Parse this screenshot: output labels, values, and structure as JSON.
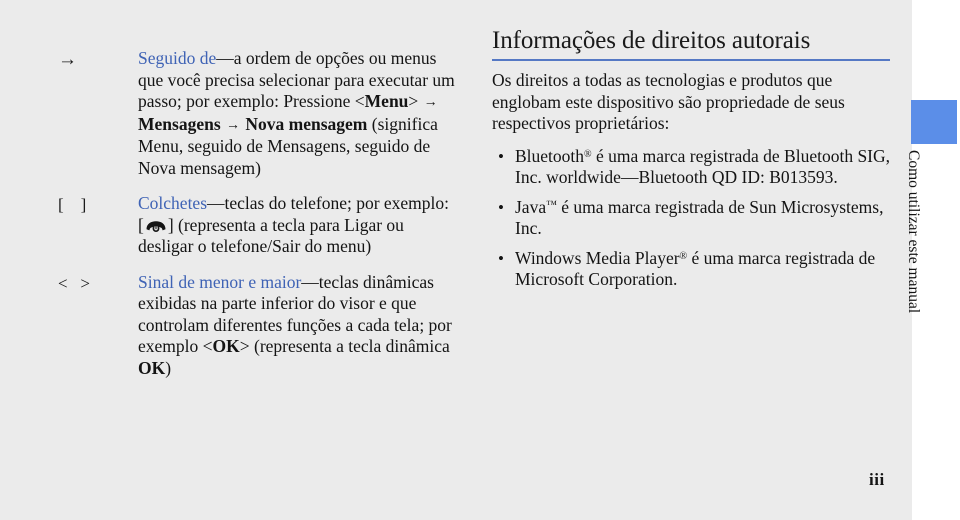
{
  "page": {
    "background_color": "#ebebeb",
    "folio": "iii"
  },
  "side_tab": {
    "block_color": "#5b8ee8",
    "label": "Como utilizar este manual"
  },
  "left_column": {
    "entries": [
      {
        "marker": "→",
        "marker_kind": "arrow",
        "term": "Seguido de",
        "text_before_bold": "—a ordem de opções ou menus que você precisa selecionar para executar um passo; por exemplo: Pressione <",
        "bold_1": "Menu",
        "after_bold_1": ">",
        "arrow_1": "→",
        "bold_2": "Mensagens",
        "arrow_2": "→",
        "bold_3": "Nova mensagem",
        "tail": "(significa Menu, seguido de Mensagens, seguido de Nova mensagem)"
      },
      {
        "marker": "[    ]",
        "marker_kind": "brackets",
        "term": "Colchetes",
        "text_before_glyph": "—teclas do telefone; por exemplo: [",
        "glyph": "phone-power-key-icon",
        "text_after_glyph": "] (representa a tecla para Ligar ou desligar o telefone/Sair do menu)"
      },
      {
        "marker": "<   >",
        "marker_kind": "angle-brackets",
        "term": "Sinal de menor e maior",
        "text_before_bold": "—teclas dinâmicas exibidas na parte inferior do visor e que controlam diferentes funções a cada tela; por exemplo <",
        "bold_1": "OK",
        "after_bold_1": "> (representa a tecla dinâmica ",
        "bold_2": "OK",
        "tail": ")"
      }
    ],
    "term_color": "#3f63b5"
  },
  "right_column": {
    "title": "Informações de direitos autorais",
    "rule_color": "#5578c4",
    "intro": "Os direitos a todas as tecnologias e produtos que englobam este dispositivo são propriedade de seus respectivos proprietários:",
    "bullets": [
      {
        "dot": "•",
        "name": "Bluetooth",
        "mark": "®",
        "rest": " é uma marca registrada de Bluetooth SIG, Inc. worldwide—Bluetooth QD ID: B013593."
      },
      {
        "dot": "•",
        "name": "Java",
        "mark": "™",
        "rest": " é uma marca registrada de Sun Microsystems, Inc."
      },
      {
        "dot": "•",
        "name": "Windows Media Player",
        "mark": "®",
        "rest": " é uma marca registrada de Microsoft Corporation."
      }
    ]
  }
}
